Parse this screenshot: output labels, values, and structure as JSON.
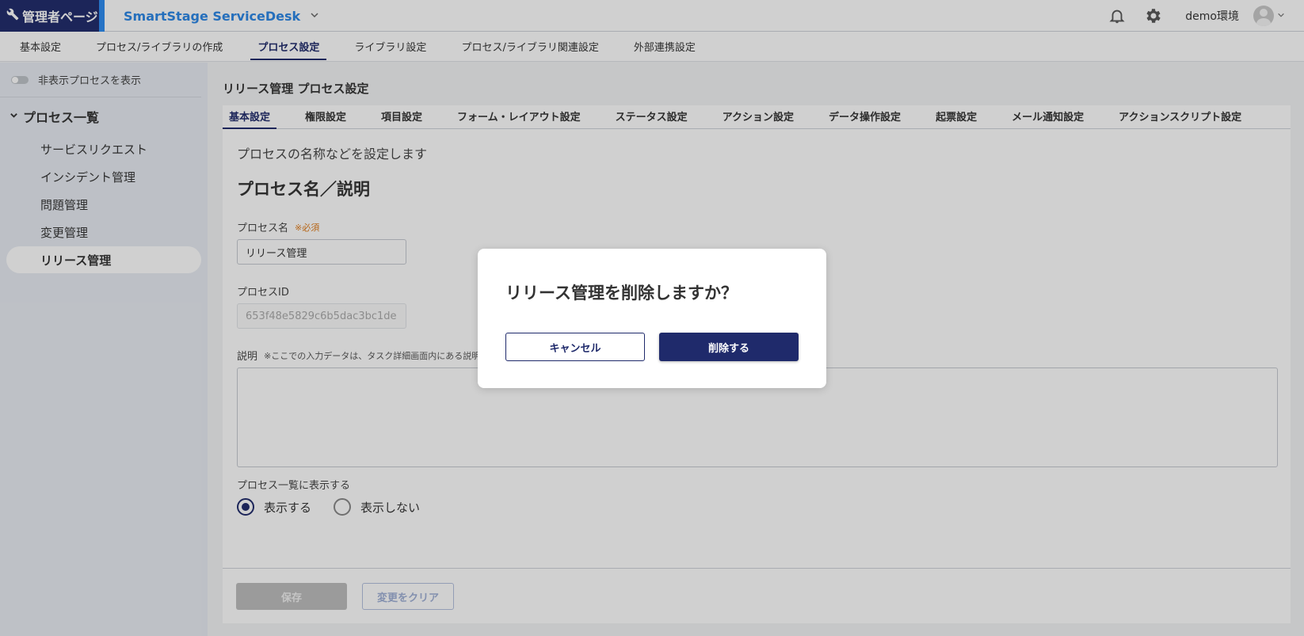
{
  "header": {
    "admin_label": "管理者ページ",
    "app_title": "SmartStage ServiceDesk",
    "user_name": "demo環境",
    "icons": [
      "wrench-icon",
      "chevron-down-icon",
      "bell-icon",
      "gear-icon",
      "user-avatar-icon"
    ]
  },
  "main_tabs": [
    {
      "label": "基本設定"
    },
    {
      "label": "プロセス/ライブラリの作成"
    },
    {
      "label": "プロセス設定",
      "active": true
    },
    {
      "label": "ライブラリ設定"
    },
    {
      "label": "プロセス/ライブラリ関連設定"
    },
    {
      "label": "外部連携設定"
    }
  ],
  "sidebar": {
    "toggle_label": "非表示プロセスを表示",
    "list_header": "プロセス一覧",
    "items": [
      {
        "label": "サービスリクエスト"
      },
      {
        "label": "インシデント管理"
      },
      {
        "label": "問題管理"
      },
      {
        "label": "変更管理"
      },
      {
        "label": "リリース管理",
        "active": true
      }
    ]
  },
  "content": {
    "page_heading": "リリース管理 プロセス設定",
    "sub_tabs": [
      {
        "label": "基本設定",
        "active": true
      },
      {
        "label": "権限設定"
      },
      {
        "label": "項目設定"
      },
      {
        "label": "フォーム・レイアウト設定"
      },
      {
        "label": "ステータス設定"
      },
      {
        "label": "アクション設定"
      },
      {
        "label": "データ操作設定"
      },
      {
        "label": "起票設定"
      },
      {
        "label": "メール通知設定"
      },
      {
        "label": "アクションスクリプト設定"
      }
    ],
    "description": "プロセスの名称などを設定します",
    "section_title": "プロセス名／説明",
    "process_name_label": "プロセス名",
    "required_label": "※必須",
    "process_name_value": "リリース管理",
    "process_id_label": "プロセスID",
    "process_id_value": "653f48e5829c6b5dac3bc1de",
    "desc_label": "説明",
    "desc_note": "※ここでの入力データは、タスク詳細画面内にある説明",
    "list_display_label": "プロセス一覧に表示する",
    "radio_show": "表示する",
    "radio_hide": "表示しない",
    "radio_selected": "表示する",
    "save_label": "保存",
    "clear_label": "変更をクリア"
  },
  "dialog": {
    "title": "リリース管理を削除しますか？",
    "cancel_label": "キャンセル",
    "delete_label": "削除する"
  },
  "colors": {
    "brand_navy": "#1f2a6b",
    "accent_blue": "#2a86e6",
    "required_orange": "#e07b1a"
  }
}
